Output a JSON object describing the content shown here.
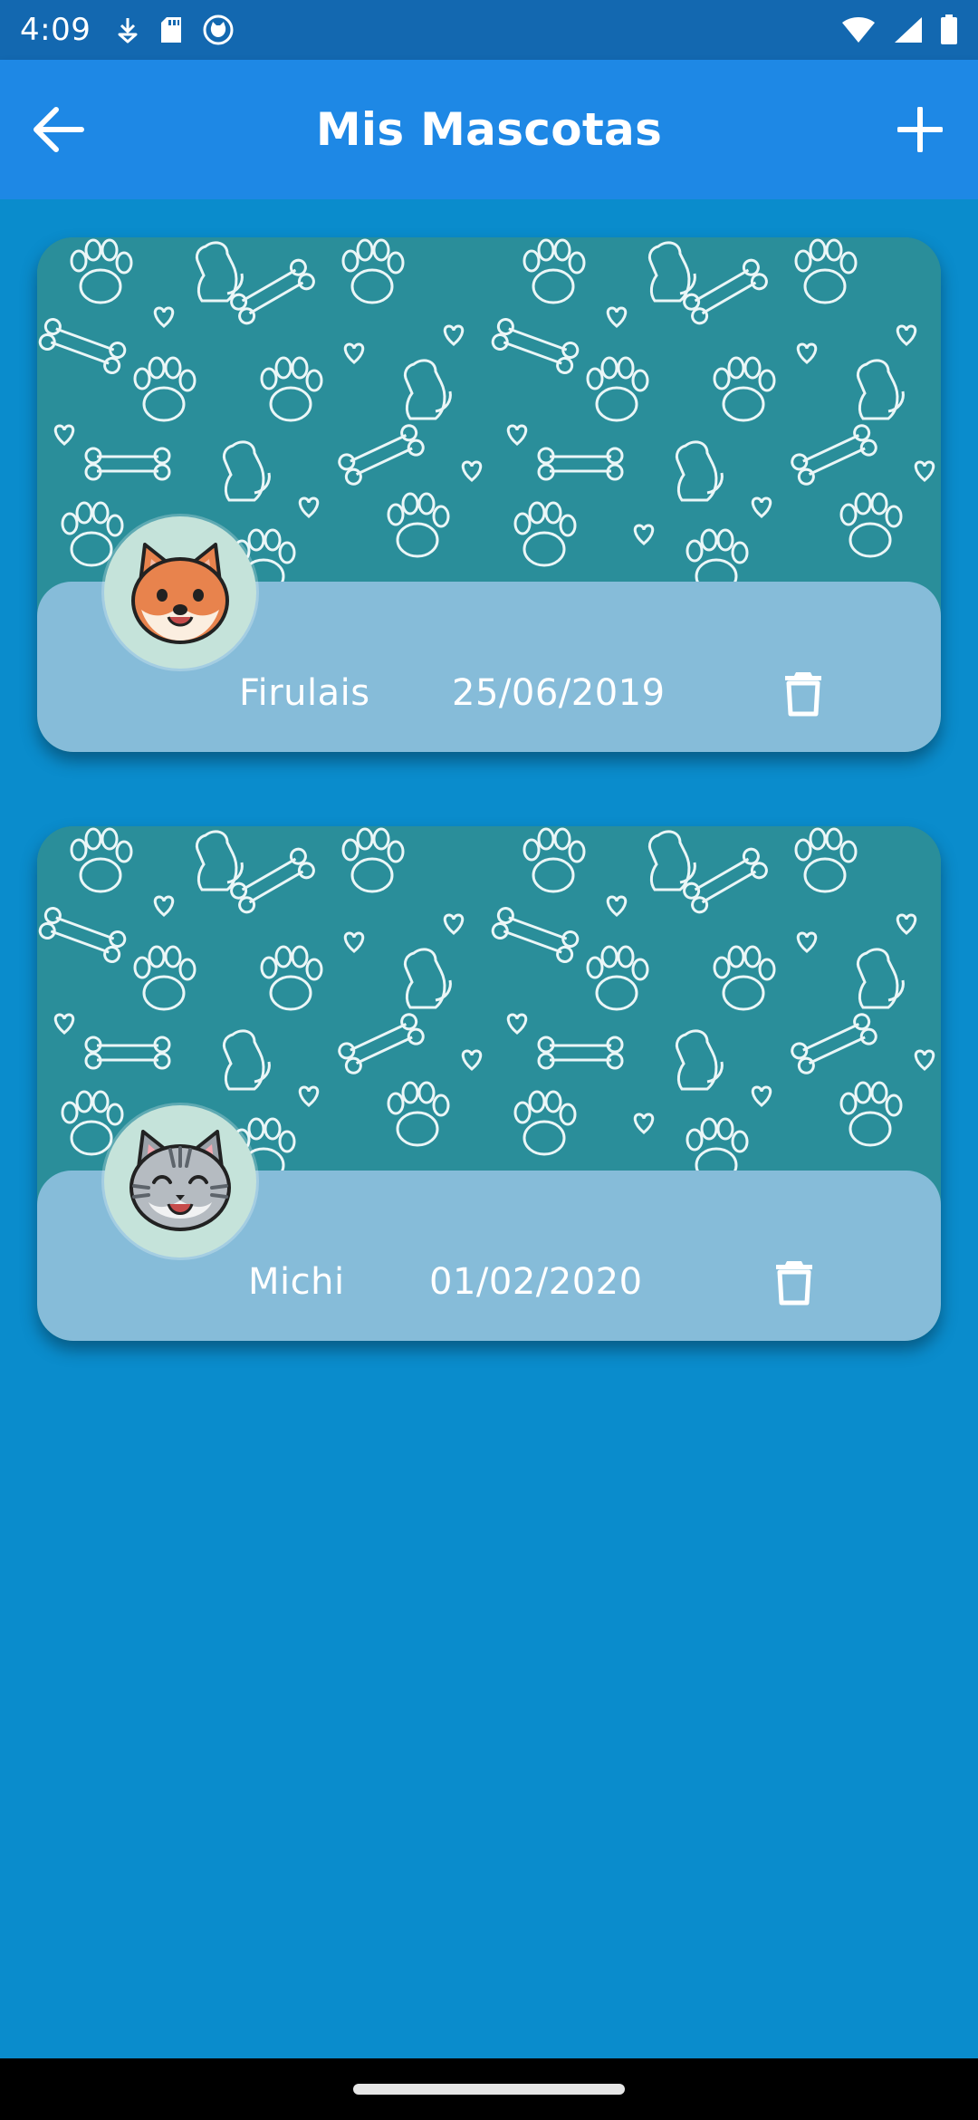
{
  "status_bar": {
    "time": "4:09",
    "left_icons": [
      "download-icon",
      "sd-card-icon",
      "cat-app-icon"
    ],
    "right_icons": [
      "wifi-icon",
      "signal-icon",
      "battery-icon"
    ]
  },
  "app_bar": {
    "title": "Mis Mascotas",
    "back_icon": "arrow-left-icon",
    "add_icon": "plus-icon"
  },
  "pets": [
    {
      "name": "Firulais",
      "date": "25/06/2019",
      "avatar": "dog-icon"
    },
    {
      "name": "Michi",
      "date": "01/02/2020",
      "avatar": "cat-icon"
    }
  ],
  "colors": {
    "status_bar": "#1368b0",
    "app_bar": "#1e88e5",
    "background": "#0a8ccc",
    "card_pattern": "#2a8e9a",
    "card_info": "#86bcd9",
    "avatar_bg": "#c5e3da"
  }
}
